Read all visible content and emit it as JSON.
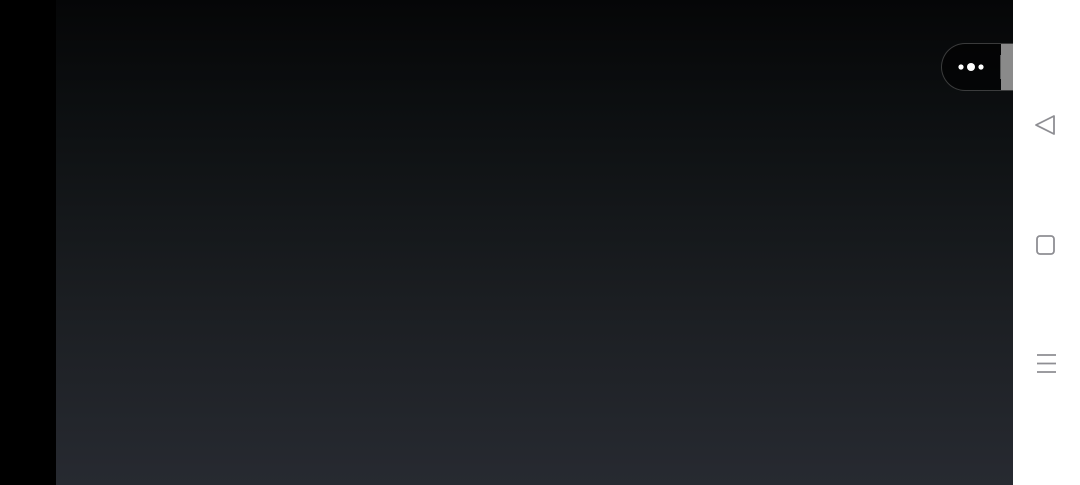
{
  "screen": {
    "content_background": "dark-gradient",
    "colors": {
      "left_bar": "#000000",
      "content_top": "#050607",
      "content_bottom": "#272a31",
      "nav_bar": "#ffffff",
      "nav_icon": "#8e8e93",
      "capsule_close_bg": "#8a8a8a"
    }
  },
  "capsule": {
    "more_icon": "more-dots-icon",
    "close_icon": "target-circle-icon"
  },
  "navigation_bar": {
    "back_icon": "back-triangle-icon",
    "home_icon": "home-square-icon",
    "menu_icon": "menu-lines-icon"
  }
}
